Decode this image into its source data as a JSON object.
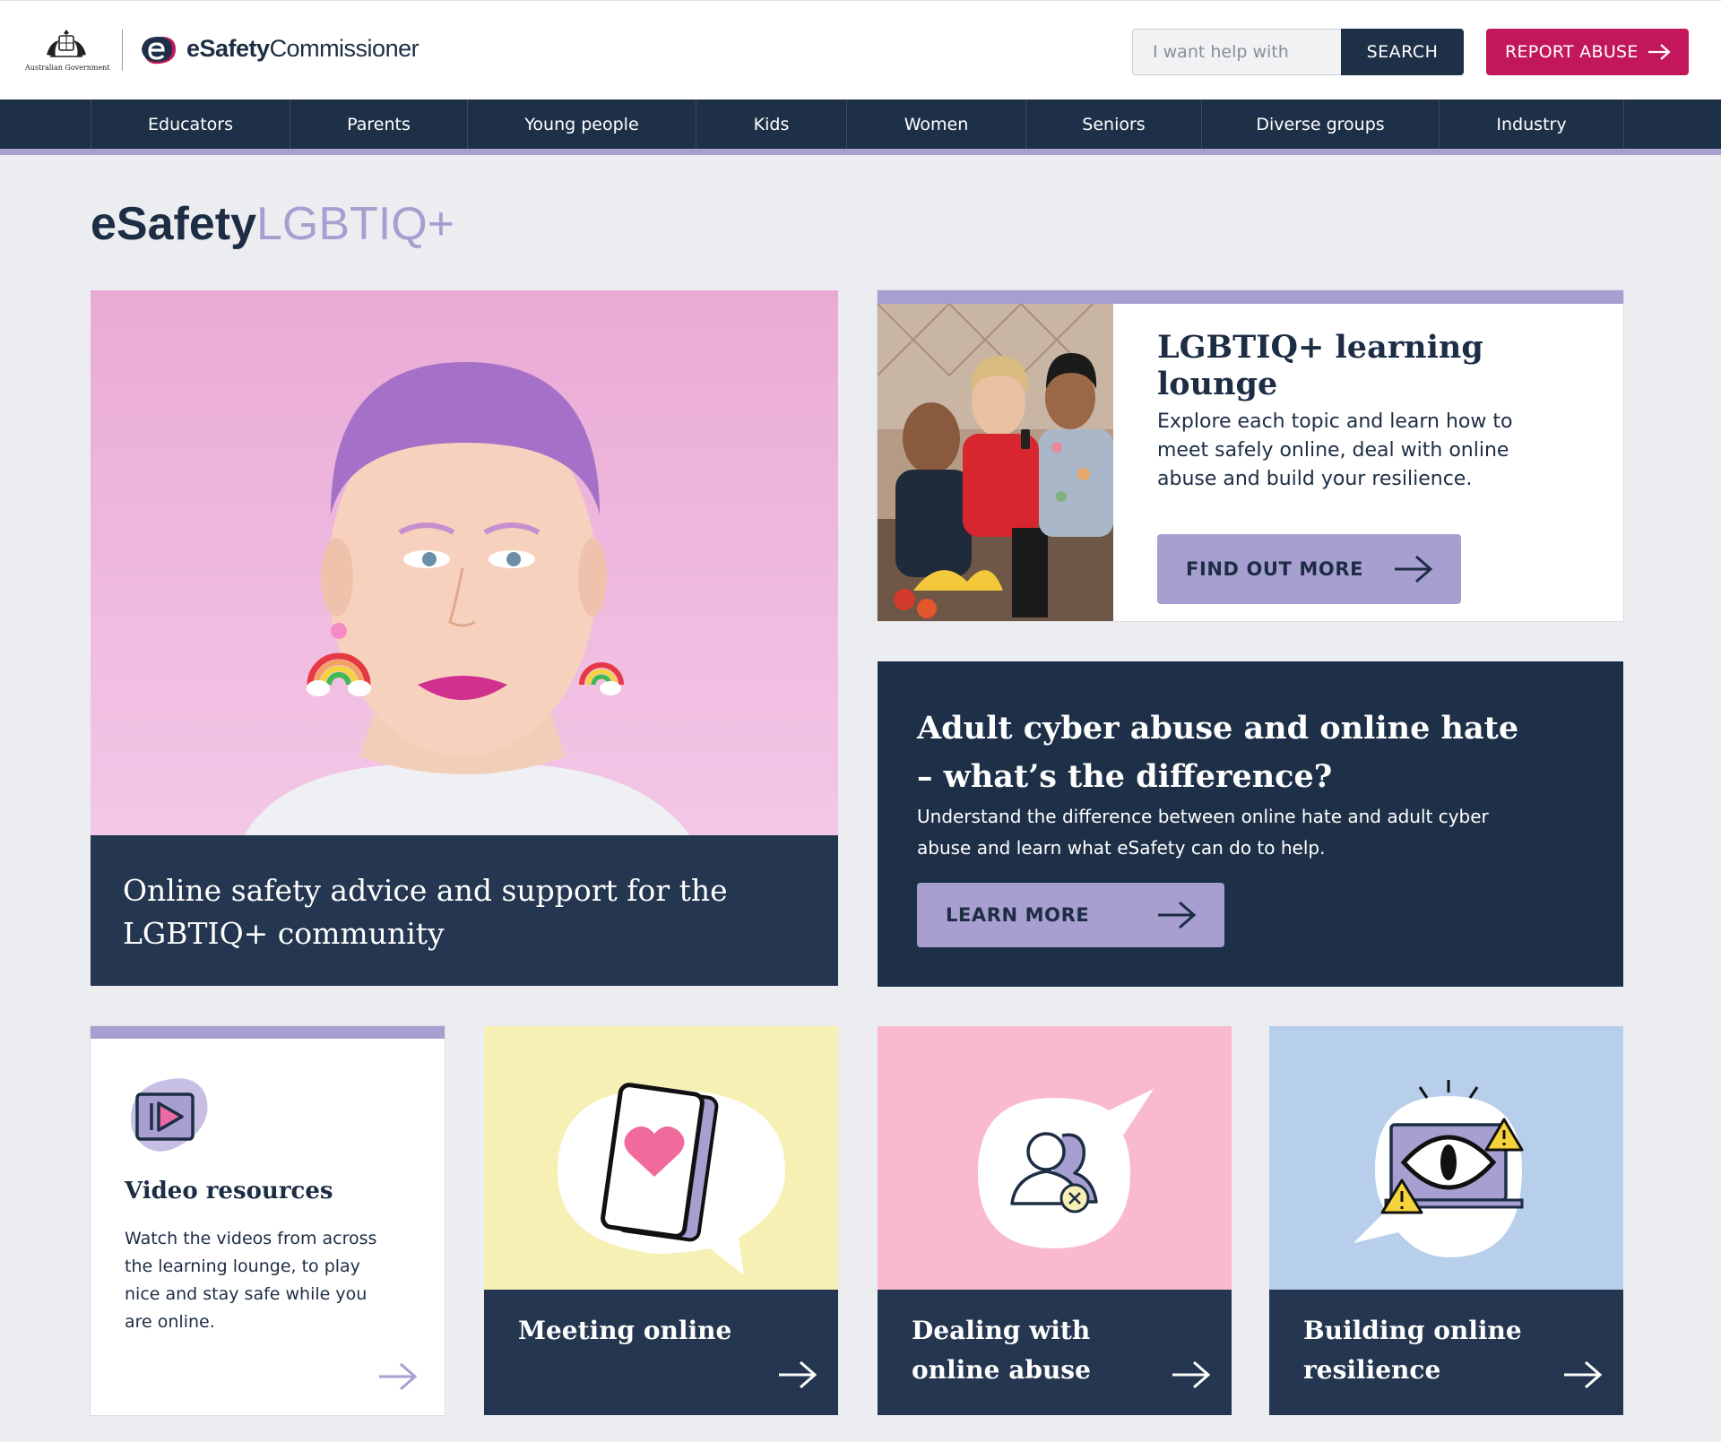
{
  "header": {
    "gov_text": "Australian Government",
    "brand_bold": "eSafety",
    "brand_light": "Commissioner",
    "search_placeholder": "I want help with",
    "search_label": "SEARCH",
    "report_label": "REPORT ABUSE"
  },
  "nav": {
    "items": [
      "Educators",
      "Parents",
      "Young people",
      "Kids",
      "Women",
      "Seniors",
      "Diverse groups",
      "Industry"
    ]
  },
  "page": {
    "title_bold": "eSafety",
    "title_light": "LGBTIQ+"
  },
  "hero": {
    "caption": "Online safety advice and support for the LGBTIQ+ community"
  },
  "lounge": {
    "title": "LGBTIQ+ learning lounge",
    "text": "Explore each topic and learn how to meet safely online, deal with online abuse and build your resilience.",
    "button": "FIND OUT MORE"
  },
  "difference": {
    "title": "Adult cyber abuse and online hate – what’s the difference?",
    "text": "Understand the difference between online hate and adult cyber abuse and learn what eSafety can do to help.",
    "button": "LEARN MORE"
  },
  "cards": {
    "video": {
      "title": "Video resources",
      "text": "Watch the videos from across the learning lounge, to play nice and stay safe while you are online."
    },
    "meeting": {
      "label": "Meeting online"
    },
    "dealing": {
      "label": "Dealing with online abuse"
    },
    "building": {
      "label": "Building online resilience"
    }
  },
  "colors": {
    "navy": "#1e3048",
    "lilac": "#a89fd1",
    "report_red": "#c2185b",
    "yellow": "#f6f0b5",
    "pink": "#f9bacd",
    "blue": "#b7cfea"
  },
  "icons": [
    "australian-crest-icon",
    "esafety-logo-icon",
    "arrow-right-icon",
    "video-play-icon",
    "phone-heart-icon",
    "user-block-icon",
    "eye-warning-icon"
  ]
}
